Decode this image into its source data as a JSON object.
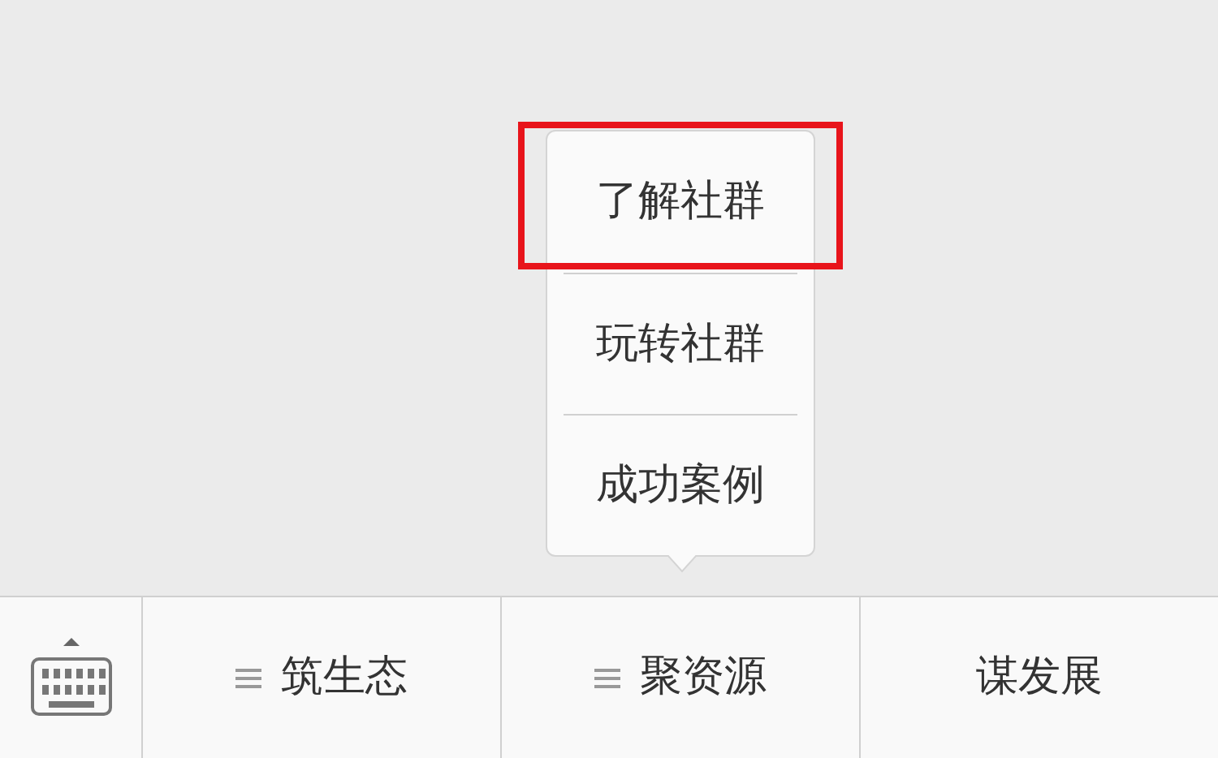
{
  "popup_menu": {
    "items": [
      {
        "label": "了解社群",
        "highlighted": true
      },
      {
        "label": "玩转社群",
        "highlighted": false
      },
      {
        "label": "成功案例",
        "highlighted": false
      }
    ]
  },
  "bottom_menu": {
    "tabs": [
      {
        "label": "筑生态",
        "has_submenu": true
      },
      {
        "label": "聚资源",
        "has_submenu": true
      },
      {
        "label": "谋发展",
        "has_submenu": false
      }
    ]
  }
}
